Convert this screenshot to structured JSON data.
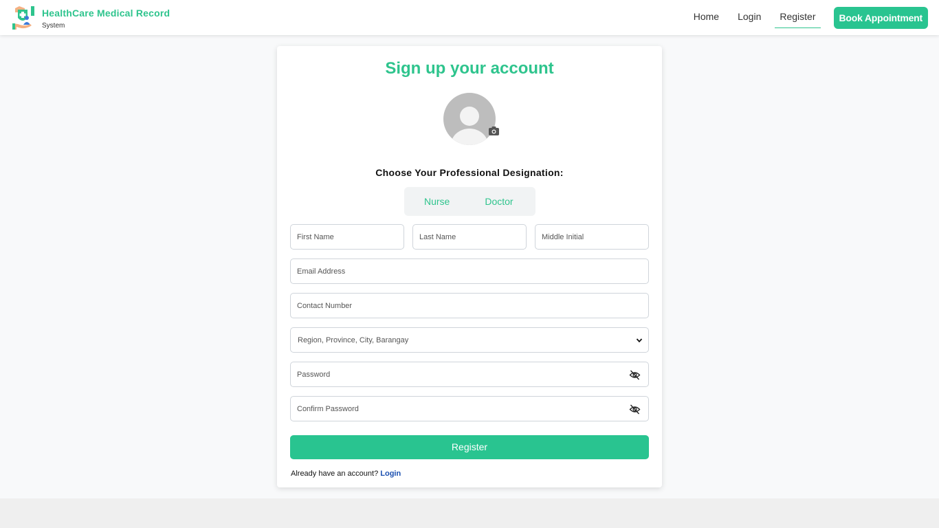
{
  "nav": {
    "brand_title": "HealthCare Medical Record",
    "brand_subtitle": "System",
    "links": [
      "Home",
      "Login",
      "Register"
    ],
    "active": "Register",
    "cta": "Book Appointment"
  },
  "form": {
    "title": "Sign up your account",
    "designation_label": "Choose Your Professional Designation:",
    "designations": [
      "Nurse",
      "Doctor"
    ],
    "fields": {
      "first_name": "First Name",
      "last_name": "Last Name",
      "middle_initial": "Middle Initial",
      "email": "Email Address",
      "contact": "Contact Number",
      "address_select": "Region, Province, City, Barangay",
      "password": "Password",
      "confirm_password": "Confirm Password"
    },
    "submit": "Register",
    "login_prompt": "Already have an account?",
    "login_link": "Login"
  },
  "colors": {
    "accent": "#29c490",
    "link": "#1a4fb0",
    "page_bg": "#f8f9fa"
  },
  "icons": [
    "hospital-logo-icon",
    "user-avatar-icon",
    "camera-icon",
    "chevron-down-icon",
    "eye-slash-icon"
  ]
}
